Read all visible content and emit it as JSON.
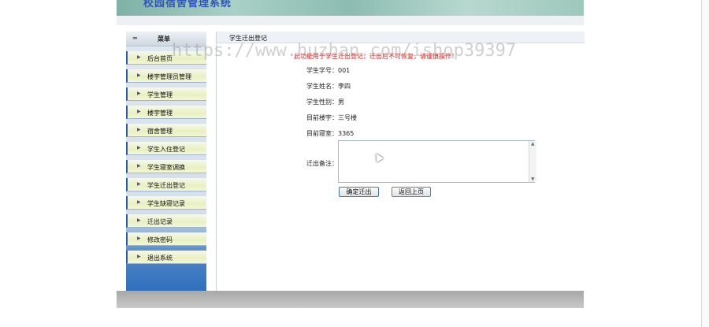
{
  "banner": {
    "title": "校园宿舍管理系统"
  },
  "sidebar": {
    "header": "菜单",
    "items": [
      {
        "label": "后台首页"
      },
      {
        "label": "楼宇管理员管理"
      },
      {
        "label": "学生管理"
      },
      {
        "label": "楼宇管理"
      },
      {
        "label": "宿舍管理"
      },
      {
        "label": "学生入住登记"
      },
      {
        "label": "学生寝室调换"
      },
      {
        "label": "学生迁出登记"
      },
      {
        "label": "学生缺寝记录"
      },
      {
        "label": "迁出记录"
      },
      {
        "label": "修改密码"
      },
      {
        "label": "退出系统"
      }
    ]
  },
  "content": {
    "title": "学生迁出登记",
    "notice": "此功能用于学生迁出登记，迁出后不可恢复，请谨慎操作！",
    "fields": [
      {
        "label": "学生学号：",
        "value": "001"
      },
      {
        "label": "学生姓名：",
        "value": "李四"
      },
      {
        "label": "学生性别：",
        "value": "男"
      },
      {
        "label": "目前楼宇：",
        "value": "三号楼"
      },
      {
        "label": "目前寝室：",
        "value": "3365"
      }
    ],
    "remark_label": "迁出备注：",
    "remark_value": "",
    "confirm_button": "确定迁出",
    "back_button": "返回上页"
  },
  "watermark": "https://www.huzhan.com/ishop39397"
}
